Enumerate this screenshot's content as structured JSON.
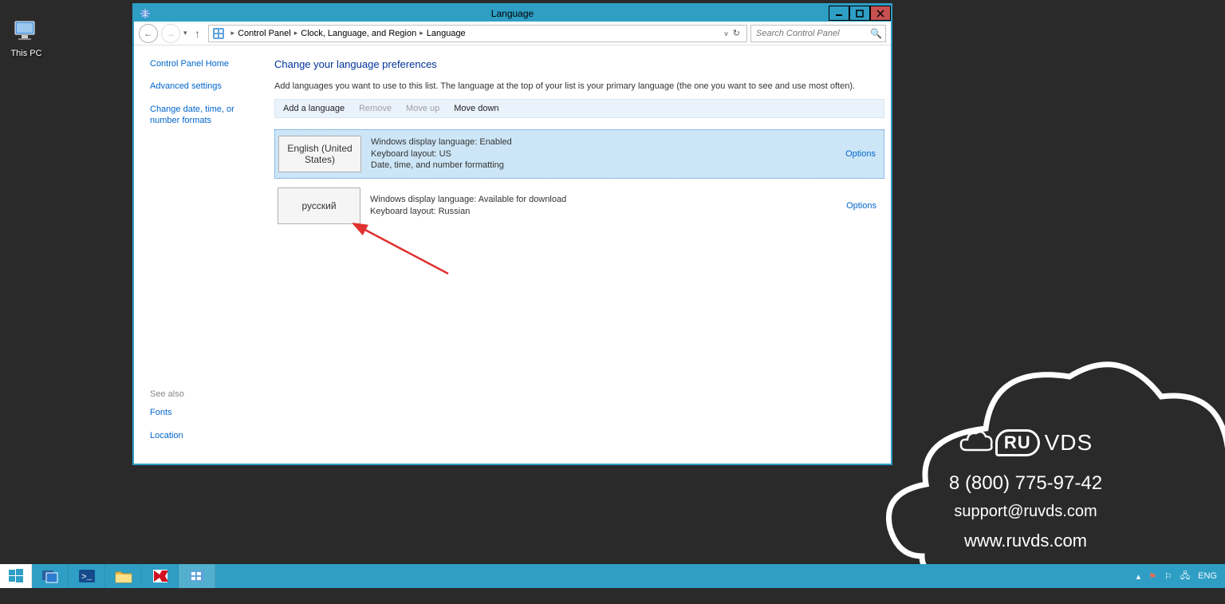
{
  "desktop": {
    "this_pc": "This PC"
  },
  "window": {
    "title": "Language",
    "breadcrumb": [
      "Control Panel",
      "Clock, Language, and Region",
      "Language"
    ],
    "search_placeholder": "Search Control Panel"
  },
  "sidebar": {
    "links": [
      "Control Panel Home",
      "Advanced settings",
      "Change date, time, or number formats"
    ],
    "see_also_label": "See also",
    "see_also": [
      "Fonts",
      "Location"
    ]
  },
  "content": {
    "heading": "Change your language preferences",
    "description": "Add languages you want to use to this list. The language at the top of your list is your primary language (the one you want to see and use most often).",
    "commands": {
      "add": "Add a language",
      "remove": "Remove",
      "move_up": "Move up",
      "move_down": "Move down"
    },
    "languages": [
      {
        "tile": "English (United States)",
        "lines": [
          "Windows display language: Enabled",
          "Keyboard layout: US",
          "Date, time, and number formatting"
        ],
        "options": "Options",
        "selected": true
      },
      {
        "tile": "русский",
        "lines": [
          "Windows display language: Available for download",
          "Keyboard layout: Russian"
        ],
        "options": "Options",
        "selected": false
      }
    ]
  },
  "watermark": {
    "brand": "VDS",
    "brand_prefix": "RU",
    "phone": "8 (800) 775-97-42",
    "email": "support@ruvds.com",
    "site": "www.ruvds.com"
  },
  "taskbar": {
    "lang": "ENG"
  }
}
